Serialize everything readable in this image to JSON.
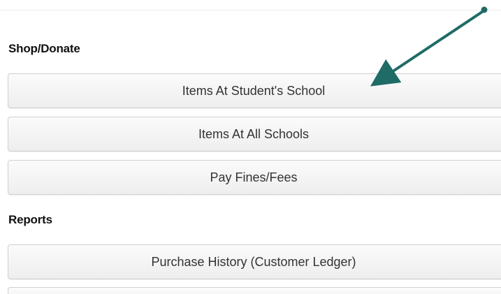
{
  "shop_donate": {
    "header": "Shop/Donate",
    "items": [
      {
        "label": "Items At Student's School"
      },
      {
        "label": "Items At All Schools"
      },
      {
        "label": "Pay Fines/Fees"
      }
    ]
  },
  "reports": {
    "header": "Reports",
    "items": [
      {
        "label": "Purchase History (Customer Ledger)"
      }
    ]
  },
  "annotation": {
    "arrow_color": "#1f6b66",
    "points_to": "Items At Student's School"
  }
}
